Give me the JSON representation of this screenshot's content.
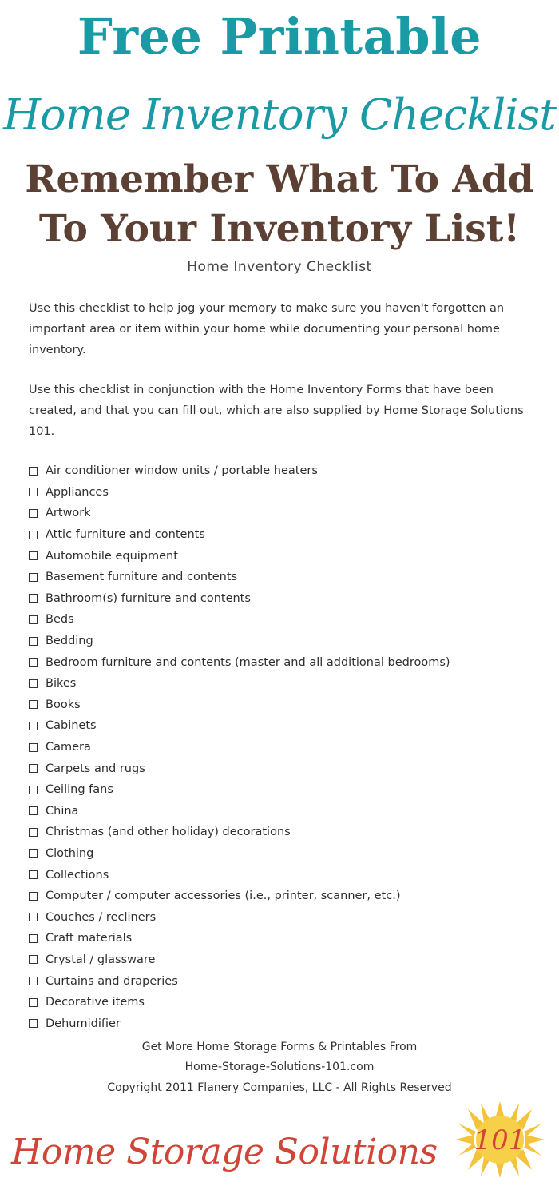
{
  "header": {
    "line1": "Free Printable",
    "line2": "Home Inventory Checklist",
    "subtitle_line1": "Remember What To Add",
    "subtitle_line2": "To Your Inventory List!"
  },
  "document": {
    "title": "Home Inventory Checklist",
    "paragraph1": "Use this checklist to help jog your memory to make sure you haven't forgotten an important area or item within your home while documenting your personal home inventory.",
    "paragraph2": "Use this checklist in conjunction with the Home Inventory Forms that have been created, and that you can fill out, which are also supplied by Home Storage Solutions 101.",
    "checklist": [
      {
        "label": "Air conditioner window units / portable heaters",
        "checked": false
      },
      {
        "label": "Appliances",
        "checked": false
      },
      {
        "label": "Artwork",
        "checked": false
      },
      {
        "label": "Attic furniture and contents",
        "checked": false
      },
      {
        "label": "Automobile equipment",
        "checked": false
      },
      {
        "label": "Basement furniture and contents",
        "checked": false
      },
      {
        "label": "Bathroom(s) furniture and contents",
        "checked": false
      },
      {
        "label": "Beds",
        "checked": false
      },
      {
        "label": "Bedding",
        "checked": false
      },
      {
        "label": "Bedroom furniture and contents (master and all additional bedrooms)",
        "checked": false
      },
      {
        "label": "Bikes",
        "checked": false
      },
      {
        "label": "Books",
        "checked": false
      },
      {
        "label": "Cabinets",
        "checked": false
      },
      {
        "label": "Camera",
        "checked": false
      },
      {
        "label": "Carpets and rugs",
        "checked": false
      },
      {
        "label": "Ceiling fans",
        "checked": false
      },
      {
        "label": "China",
        "checked": false
      },
      {
        "label": "Christmas (and other holiday) decorations",
        "checked": false
      },
      {
        "label": "Clothing",
        "checked": false
      },
      {
        "label": "Collections",
        "checked": false
      },
      {
        "label": "Computer / computer accessories (i.e., printer, scanner, etc.)",
        "checked": false
      },
      {
        "label": "Couches / recliners",
        "checked": false
      },
      {
        "label": "Craft materials",
        "checked": false
      },
      {
        "label": "Crystal / glassware",
        "checked": false
      },
      {
        "label": "Curtains and draperies",
        "checked": false
      },
      {
        "label": "Decorative items",
        "checked": false
      },
      {
        "label": "Dehumidifier",
        "checked": false
      }
    ]
  },
  "footer": {
    "line1": "Get More Home Storage Forms & Printables From",
    "line2": "Home-Storage-Solutions-101.com",
    "line3": "Copyright 2011 Flanery Companies, LLC - All Rights Reserved"
  },
  "brand": {
    "name": "Home Storage Solutions",
    "logo_number": "101",
    "logo_icon": "sun-icon",
    "colors": {
      "teal": "#1a9aa5",
      "brown": "#5c4033",
      "red": "#d14538",
      "sun": "#f5c33b"
    }
  }
}
